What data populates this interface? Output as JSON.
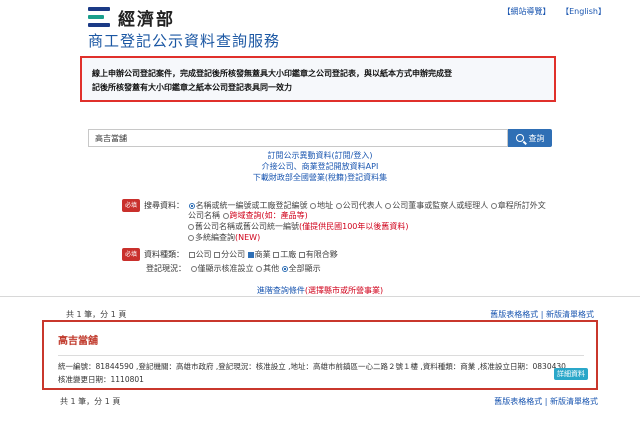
{
  "header": {
    "ministry": "經濟部",
    "sitemap": "【網站導覽】",
    "english": "【English】",
    "site_title": "商工登記公示資料查詢服務"
  },
  "notice": {
    "line1": "線上申辦公司登記案件，完成登記後所核發無蓋具大小印鑑章之公司登記表，與以紙本方式申辦完成登",
    "line2": "記後所核發蓋有大小印鑑章之紙本公司登記表具同一效力"
  },
  "search": {
    "value": "高吉當舖",
    "button_label": "查詢"
  },
  "links": {
    "subscribe": "訂閱公示異動資料(訂閱/登入)",
    "api": "介接公司、商業登記開放資料API",
    "download": "下載財政部全國營業(稅籍)登記資料集"
  },
  "options": {
    "required_tag": "必填",
    "search_data_label": "搜尋資料：",
    "search_data_opts": [
      "名稱或統一編號或工廠登記編號",
      "地址",
      "公司代表人",
      "公司董事或監察人或經理人",
      "章程所訂外文"
    ],
    "search_data_cont": "公司名稱",
    "cross_search": "跨域查詢",
    "cross_search_hint": "(如：產品等)",
    "old_company": "舊公司名稱或舊公司統一編號",
    "old_company_hint": "(僅提供民國100年以後舊資料)",
    "multi_query": "多統編查詢",
    "multi_query_new": "(NEW)",
    "data_type_label": "資料種類：",
    "data_type_opts": [
      "公司",
      "分公司",
      "商業",
      "工廠",
      "有限合夥"
    ],
    "status_label": "登記現況：",
    "status_opts": [
      "僅顯示核准設立",
      "其他",
      "全部顯示"
    ]
  },
  "advanced": {
    "label": "進階查詢條件",
    "hint": "(選擇縣市或所營事業)"
  },
  "results": {
    "count_top": "共 1 筆，分 1 頁",
    "count_bottom": "共 1 筆，分 1 頁",
    "export_old": "舊版表格格式",
    "export_sep": "|",
    "export_new": "新版清單格式",
    "name": "高吉當舖",
    "detail": "統一編號：81844590 ,登記機關：高雄市政府 ,登記現況：核准設立 ,地址：高雄市前鎮區一心二路２號１樓 ,資料種類：商業 ,核准設立日期：0830430 ,核准變更日期：1110801",
    "detail_button": "詳細資料"
  },
  "colors": {
    "accent_blue": "#1b57a3",
    "alert_red": "#e0302b",
    "button_blue": "#2f6fb5",
    "detail_button": "#2aa7c9"
  }
}
